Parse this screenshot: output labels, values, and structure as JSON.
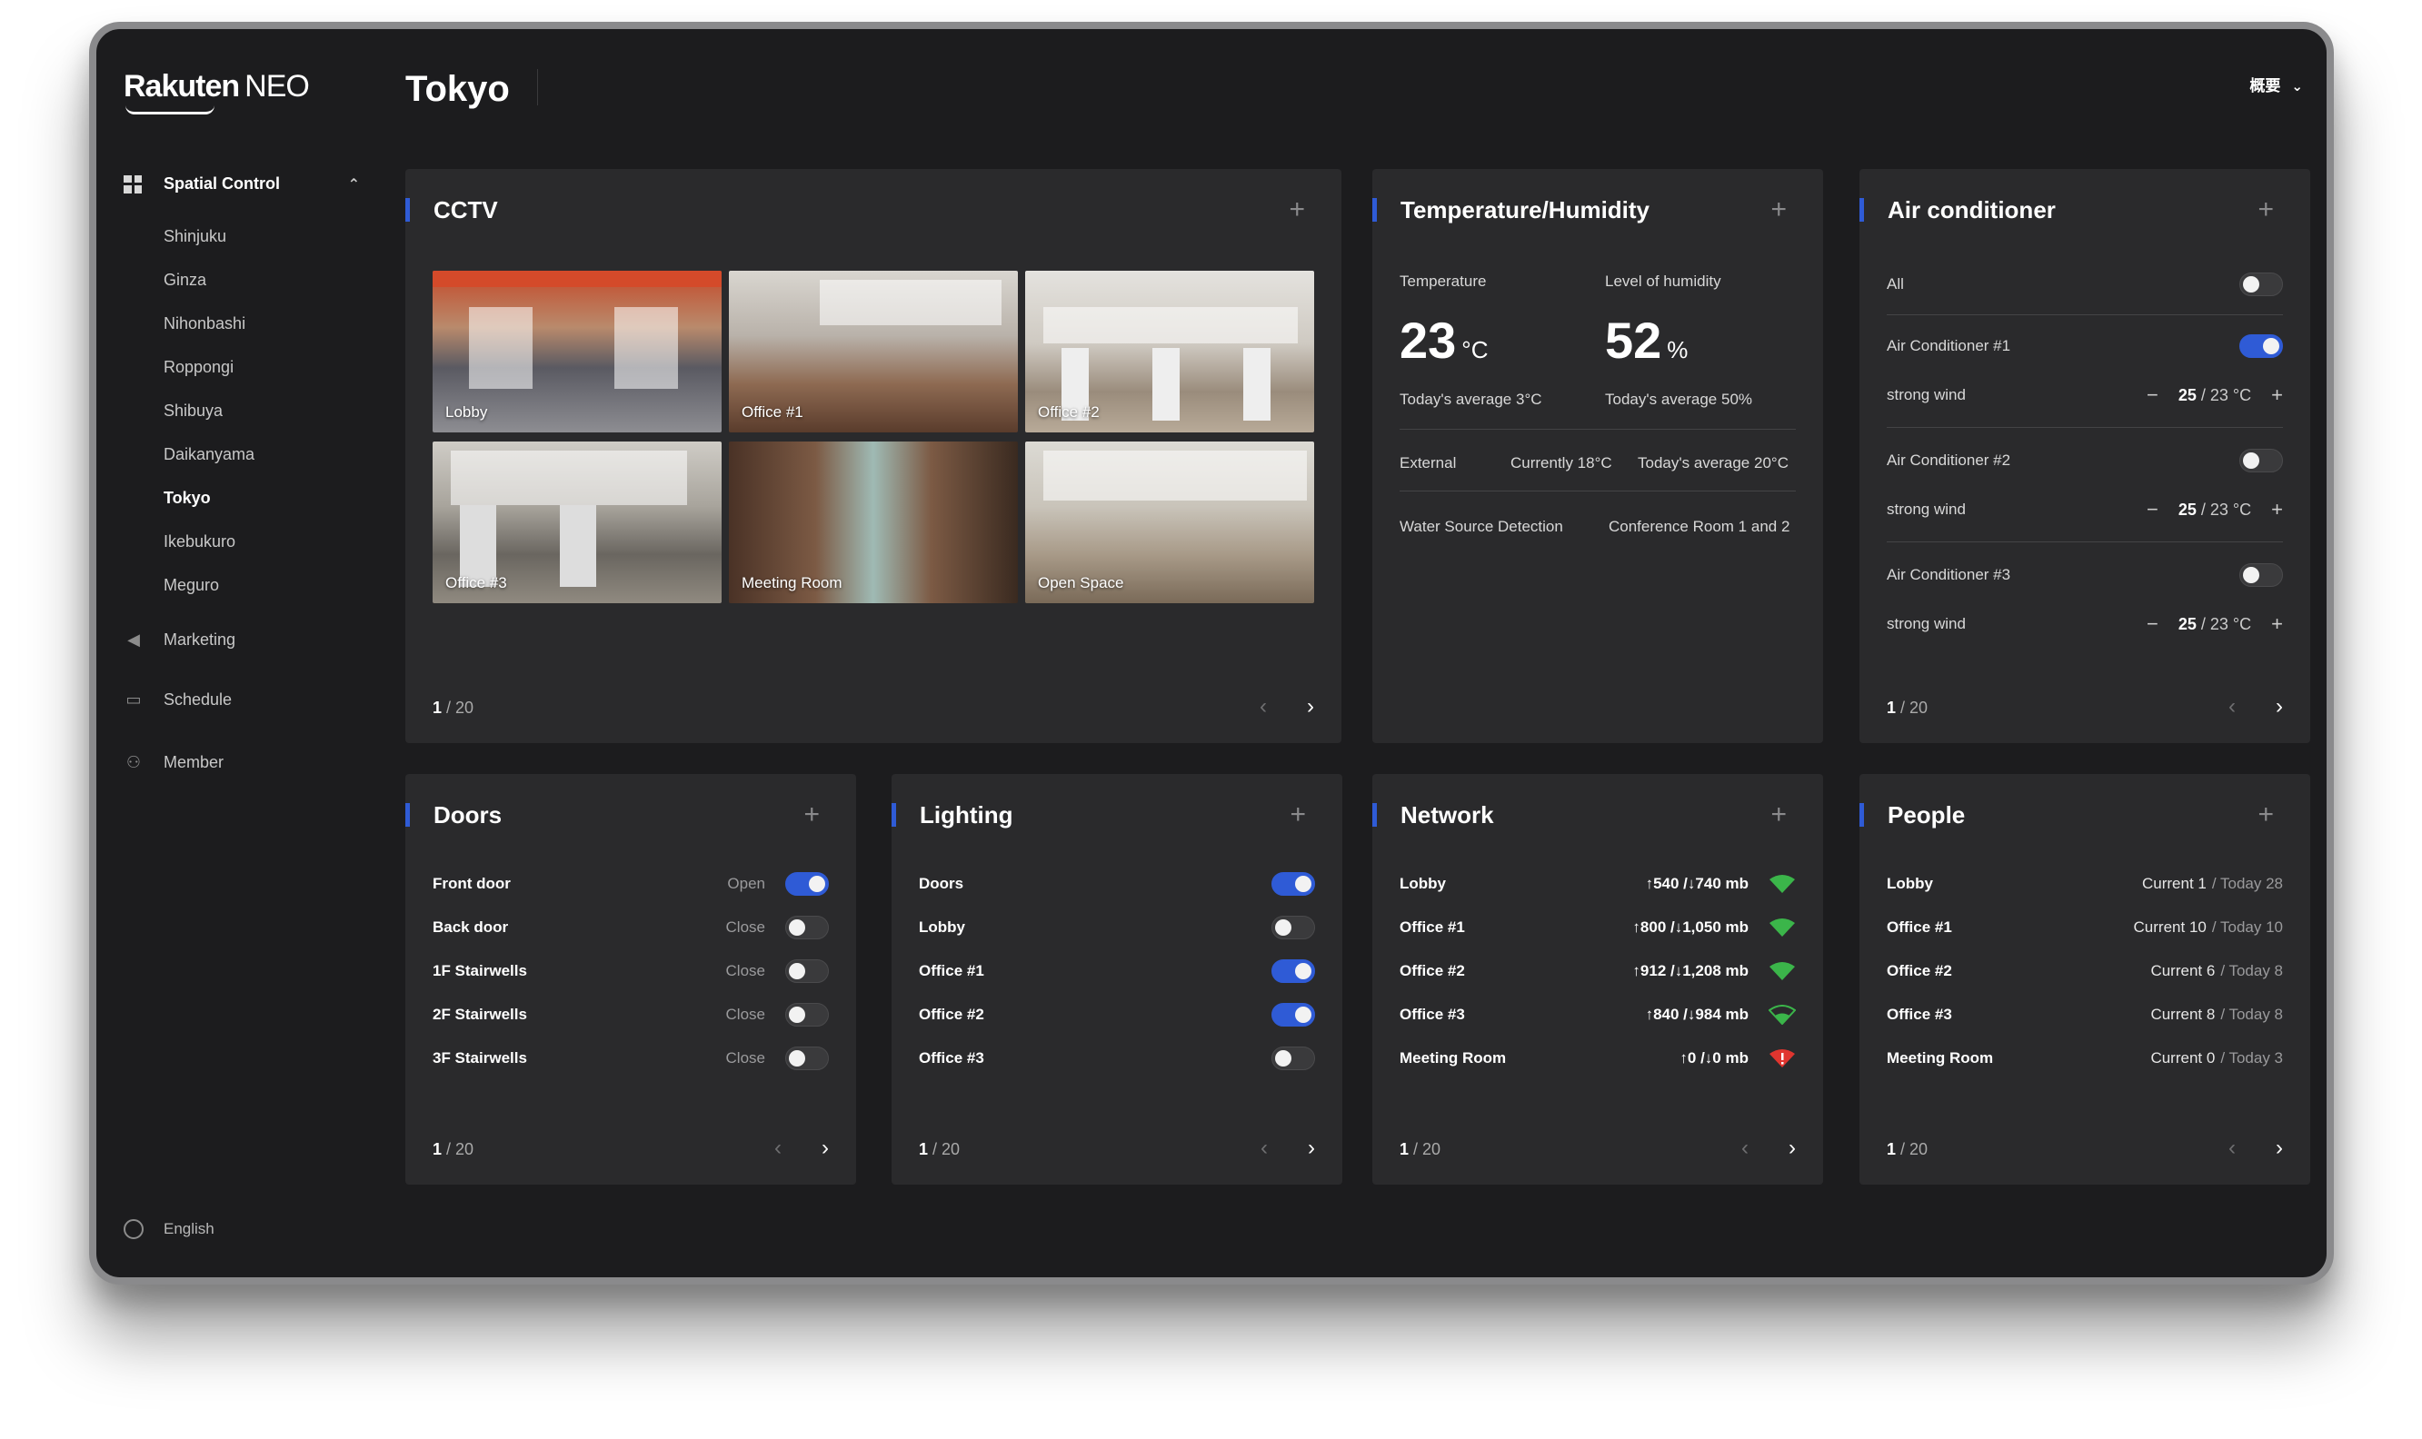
{
  "app": {
    "logo_brand": "Rakuten",
    "logo_product": "NEO"
  },
  "header": {
    "title": "Tokyo",
    "view_selector": "概要"
  },
  "sidebar": {
    "section_label": "Spatial Control",
    "locations": [
      "Shinjuku",
      "Ginza",
      "Nihonbashi",
      "Roppongi",
      "Shibuya",
      "Daikanyama",
      "Tokyo",
      "Ikebukuro",
      "Meguro"
    ],
    "active_location": "Tokyo",
    "items": [
      {
        "label": "Marketing",
        "icon": "megaphone-icon"
      },
      {
        "label": "Schedule",
        "icon": "calendar-icon"
      },
      {
        "label": "Member",
        "icon": "people-icon"
      }
    ],
    "language": "English"
  },
  "cctv": {
    "title": "CCTV",
    "cameras": [
      "Lobby",
      "Office #1",
      "Office #2",
      "Office #3",
      "Meeting Room",
      "Open Space"
    ],
    "page": "1",
    "total": "/ 20"
  },
  "temperature": {
    "title": "Temperature/Humidity",
    "temp_label": "Temperature",
    "temp_value": "23",
    "temp_unit": "°C",
    "temp_avg": "Today's average 3°C",
    "hum_label": "Level of humidity",
    "hum_value": "52",
    "hum_unit": "%",
    "hum_avg": "Today's average 50%",
    "external_label": "External",
    "external_current": "Currently 18°C",
    "external_avg": "Today's average 20°C",
    "water_label": "Water Source Detection",
    "water_value": "Conference Room 1 and 2"
  },
  "air_conditioner": {
    "title": "Air conditioner",
    "all_label": "All",
    "all_on": false,
    "units": [
      {
        "name": "Air Conditioner #1",
        "on": true,
        "mode": "strong wind",
        "current": "25",
        "target": "/ 23 °C"
      },
      {
        "name": "Air Conditioner #2",
        "on": false,
        "mode": "strong wind",
        "current": "25",
        "target": "/ 23 °C"
      },
      {
        "name": "Air Conditioner #3",
        "on": false,
        "mode": "strong wind",
        "current": "25",
        "target": "/ 23 °C"
      }
    ],
    "page": "1",
    "total": "/ 20"
  },
  "doors": {
    "title": "Doors",
    "items": [
      {
        "name": "Front door",
        "status": "Open",
        "on": true
      },
      {
        "name": "Back door",
        "status": "Close",
        "on": false
      },
      {
        "name": "1F Stairwells",
        "status": "Close",
        "on": false
      },
      {
        "name": "2F Stairwells",
        "status": "Close",
        "on": false
      },
      {
        "name": "3F Stairwells",
        "status": "Close",
        "on": false
      }
    ],
    "page": "1",
    "total": "/ 20"
  },
  "lighting": {
    "title": "Lighting",
    "items": [
      {
        "name": "Doors",
        "on": true
      },
      {
        "name": "Lobby",
        "on": false
      },
      {
        "name": "Office #1",
        "on": true
      },
      {
        "name": "Office #2",
        "on": true
      },
      {
        "name": "Office #3",
        "on": false
      }
    ],
    "page": "1",
    "total": "/ 20"
  },
  "network": {
    "title": "Network",
    "items": [
      {
        "name": "Lobby",
        "traffic": "↑540 /↓740 mb",
        "status": "strong",
        "color": "#3bb54a"
      },
      {
        "name": "Office #1",
        "traffic": "↑800 /↓1,050 mb",
        "status": "strong",
        "color": "#3bb54a"
      },
      {
        "name": "Office #2",
        "traffic": "↑912 /↓1,208 mb",
        "status": "strong",
        "color": "#3bb54a"
      },
      {
        "name": "Office #3",
        "traffic": "↑840 /↓984 mb",
        "status": "weak",
        "color": "#3bb54a"
      },
      {
        "name": "Meeting Room",
        "traffic": "↑0 /↓0 mb",
        "status": "error",
        "color": "#e0352f"
      }
    ],
    "page": "1",
    "total": "/ 20"
  },
  "people": {
    "title": "People",
    "items": [
      {
        "name": "Lobby",
        "current": "Current 1",
        "today": "/ Today 28"
      },
      {
        "name": "Office #1",
        "current": "Current 10",
        "today": "/ Today 10"
      },
      {
        "name": "Office #2",
        "current": "Current 6",
        "today": "/ Today 8"
      },
      {
        "name": "Office #3",
        "current": "Current 8",
        "today": "/ Today 8"
      },
      {
        "name": "Meeting Room",
        "current": "Current 0",
        "today": "/ Today 3"
      }
    ],
    "page": "1",
    "total": "/ 20"
  },
  "colors": {
    "accent": "#2f5bd6",
    "panel": "#2a2a2c",
    "background": "#1c1c1e"
  }
}
